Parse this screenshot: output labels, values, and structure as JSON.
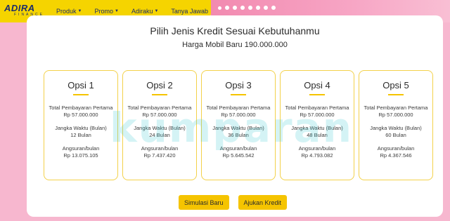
{
  "brand": {
    "logo_main": "ADIRA",
    "logo_sub": "FINANCE"
  },
  "nav": [
    {
      "label": "Produk",
      "dropdown": true
    },
    {
      "label": "Promo",
      "dropdown": true
    },
    {
      "label": "Adiraku",
      "dropdown": true
    },
    {
      "label": "Tanya Jawab",
      "dropdown": false
    }
  ],
  "carousel": {
    "dot_count": 8,
    "active_index": 0
  },
  "header": {
    "title": "Pilih Jenis Kredit Sesuai Kebutuhanmu",
    "subtitle": "Harga Mobil Baru 190.000.000"
  },
  "options": [
    {
      "title": "Opsi 1",
      "total_label": "Total Pembayaran Pertama",
      "total_value": "Rp 57.000.000",
      "term_label": "Jangka Waktu (Bulan)",
      "term_value": "12 Bulan",
      "installment_label": "Angsuran/bulan",
      "installment_value": "Rp 13.075.105"
    },
    {
      "title": "Opsi 2",
      "total_label": "Total Pembayaran Pertama",
      "total_value": "Rp 57.000.000",
      "term_label": "Jangka Waktu (Bulan)",
      "term_value": "24 Bulan",
      "installment_label": "Angsuran/bulan",
      "installment_value": "Rp 7.437.420"
    },
    {
      "title": "Opsi 3",
      "total_label": "Total Pembayaran Pertama",
      "total_value": "Rp 57.000.000",
      "term_label": "Jangka Waktu (Bulan)",
      "term_value": "36 Bulan",
      "installment_label": "Angsuran/bulan",
      "installment_value": "Rp 5.645.542"
    },
    {
      "title": "Opsi 4",
      "total_label": "Total Pembayaran Pertama",
      "total_value": "Rp 57.000.000",
      "term_label": "Jangka Waktu (Bulan)",
      "term_value": "48 Bulan",
      "installment_label": "Angsuran/bulan",
      "installment_value": "Rp 4.793.082"
    },
    {
      "title": "Opsi 5",
      "total_label": "Total Pembayaran Pertama",
      "total_value": "Rp 57.000.000",
      "term_label": "Jangka Waktu (Bulan)",
      "term_value": "60 Bulan",
      "installment_label": "Angsuran/bulan",
      "installment_value": "Rp 4.367.546"
    }
  ],
  "watermark": "kumparan",
  "buttons": {
    "simulate": "Simulasi Baru",
    "apply": "Ajukan Kredit"
  },
  "colors": {
    "accent": "#f5c400",
    "nav_bg": "#f5d400",
    "banner": "#f28ab0",
    "brand_text": "#1d2d6b"
  },
  "icons": {
    "dropdown": "chevron-down-icon"
  }
}
